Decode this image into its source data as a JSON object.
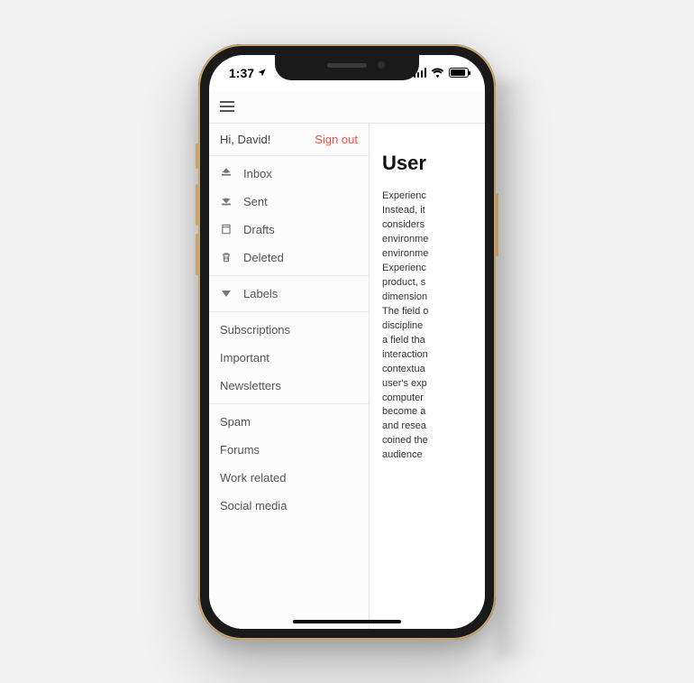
{
  "statusbar": {
    "time": "1:37"
  },
  "drawer": {
    "greeting": "Hi, David!",
    "signout": "Sign out",
    "folders": {
      "inbox": "Inbox",
      "sent": "Sent",
      "drafts": "Drafts",
      "deleted": "Deleted"
    },
    "labels_header": "Labels",
    "labels_a": {
      "subscriptions": "Subscriptions",
      "important": "Important",
      "newsletters": "Newsletters"
    },
    "labels_b": {
      "spam": "Spam",
      "forums": "Forums",
      "work": "Work related",
      "social": "Social media"
    }
  },
  "article": {
    "title": "User",
    "lines": {
      "l0": "Experienc",
      "l1": "Instead, it",
      "l2": "considers",
      "l3": "environme",
      "l4": "environme",
      "l5": "Experienc",
      "l6": "product, s",
      "l7": "dimension",
      "l8": "The field o",
      "l9": "discipline",
      "l10": "a field tha",
      "l11": "interaction",
      "l12": "contextua",
      "l13": "user's exp",
      "l14": "computer",
      "l15": "become a",
      "l16": "and resea",
      "l17": "coined the",
      "l18": "audience"
    }
  },
  "colors": {
    "accent": "#e9573f"
  }
}
